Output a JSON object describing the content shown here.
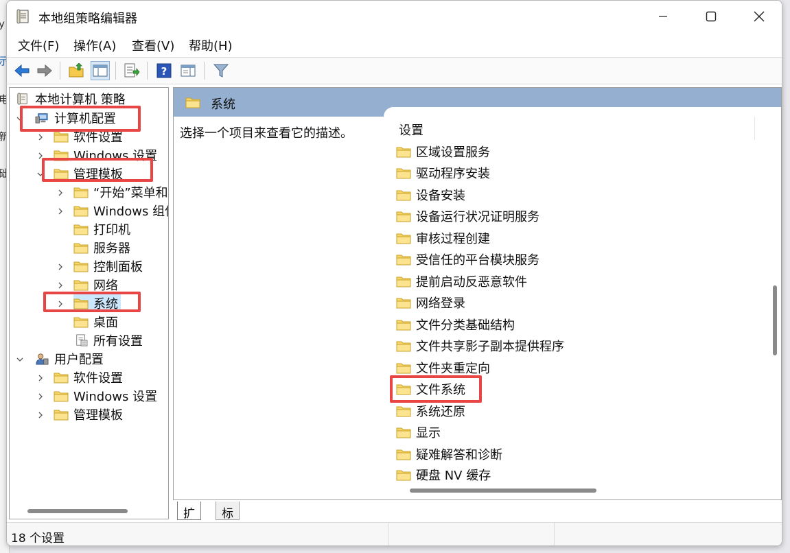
{
  "background_window": {
    "fragments": [
      "y",
      "示",
      "电",
      "新",
      "础"
    ]
  },
  "window": {
    "title": "本地组策略编辑器",
    "controls": {
      "minimize": "—",
      "maximize": "☐",
      "close": "✕"
    }
  },
  "menu": {
    "items": [
      "文件(F)",
      "操作(A)",
      "查看(V)",
      "帮助(H)"
    ]
  },
  "toolbar": {
    "buttons": [
      "back-icon",
      "forward-icon",
      "up-folder-icon",
      "show-hide-tree-icon",
      "export-list-icon",
      "help-icon",
      "properties-icon",
      "filter-icon"
    ]
  },
  "tree": {
    "root": "本地计算机 策略",
    "computer_config": "计算机配置",
    "cc_software": "软件设置",
    "cc_windows": "Windows 设置",
    "cc_admin": "管理模板",
    "start_menu": "“开始”菜单和任",
    "windows_components": "Windows 组件",
    "printers": "打印机",
    "servers": "服务器",
    "control_panel": "控制面板",
    "network": "网络",
    "system": "系统",
    "desktop": "桌面",
    "all_settings": "所有设置",
    "user_config": "用户配置",
    "uc_software": "软件设置",
    "uc_windows": "Windows 设置",
    "uc_admin": "管理模板"
  },
  "detail": {
    "header_title": "系统",
    "description": "选择一个项目来查看它的描述。",
    "column_header": "设置",
    "items": [
      "区域设置服务",
      "驱动程序安装",
      "设备安装",
      "设备运行状况证明服务",
      "审核过程创建",
      "受信任的平台模块服务",
      "提前启动反恶意软件",
      "网络登录",
      "文件分类基础结构",
      "文件共享影子副本提供程序",
      "文件夹重定向",
      "文件系统",
      "系统还原",
      "显示",
      "疑难解答和诊断",
      "硬盘 NV 缓存"
    ]
  },
  "tabs": {
    "extended": "扩展",
    "standard": "标准"
  },
  "status": {
    "text": "18 个设置"
  },
  "colors": {
    "header": "#94afcf",
    "highlight": "#e84545",
    "selected": "#cce8ff"
  }
}
